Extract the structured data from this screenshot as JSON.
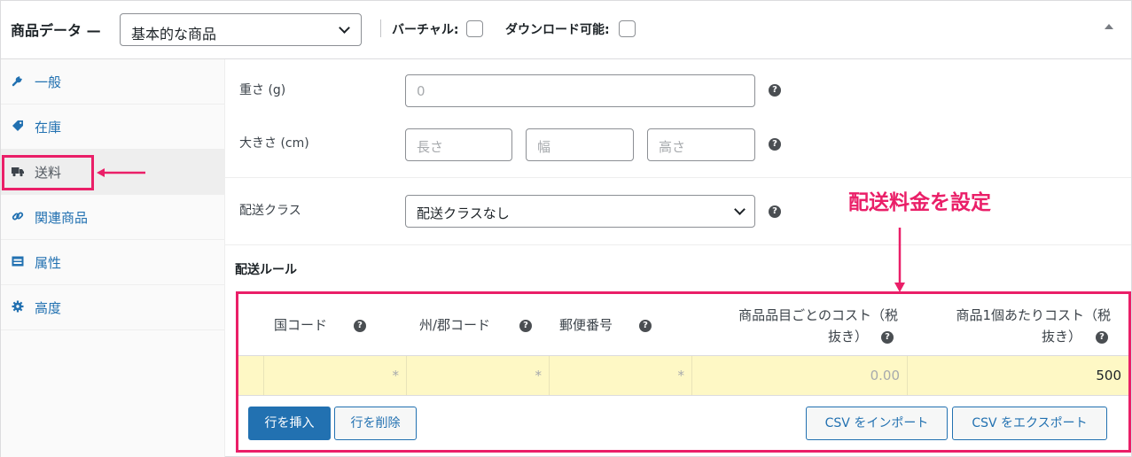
{
  "header": {
    "title": "商品データ —",
    "product_type": "基本的な商品",
    "virtual_label": "バーチャル:",
    "downloadable_label": "ダウンロード可能:"
  },
  "tabs": [
    {
      "label": "一般",
      "icon": "wrench-icon"
    },
    {
      "label": "在庫",
      "icon": "tag-icon"
    },
    {
      "label": "送料",
      "icon": "truck-icon",
      "active": true
    },
    {
      "label": "関連商品",
      "icon": "link-icon"
    },
    {
      "label": "属性",
      "icon": "table-icon"
    },
    {
      "label": "高度",
      "icon": "gear-icon"
    }
  ],
  "shipping": {
    "weight_label": "重さ (g)",
    "weight_placeholder": "0",
    "dimensions_label": "大きさ (cm)",
    "length_placeholder": "長さ",
    "width_placeholder": "幅",
    "height_placeholder": "高さ",
    "class_label": "配送クラス",
    "class_value": "配送クラスなし"
  },
  "annotation": "配送料金を設定",
  "rules": {
    "title": "配送ルール",
    "headers": {
      "country": "国コード",
      "state": "州/郡コード",
      "postcode": "郵便番号",
      "item_cost_1": "商品品目ごとのコスト（税",
      "item_cost_2": "抜き）",
      "unit_cost_1": "商品1個あたりコスト（税",
      "unit_cost_2": "抜き）"
    },
    "row": {
      "country": "*",
      "state": "*",
      "postcode": "*",
      "item_cost": "0.00",
      "unit_cost": "500"
    },
    "buttons": {
      "insert": "行を挿入",
      "delete": "行を削除",
      "import": "CSV をインポート",
      "export": "CSV をエクスポート"
    }
  },
  "colors": {
    "accent": "#ea1f68",
    "link": "#2271b1",
    "row_bg": "#fef8c5"
  }
}
